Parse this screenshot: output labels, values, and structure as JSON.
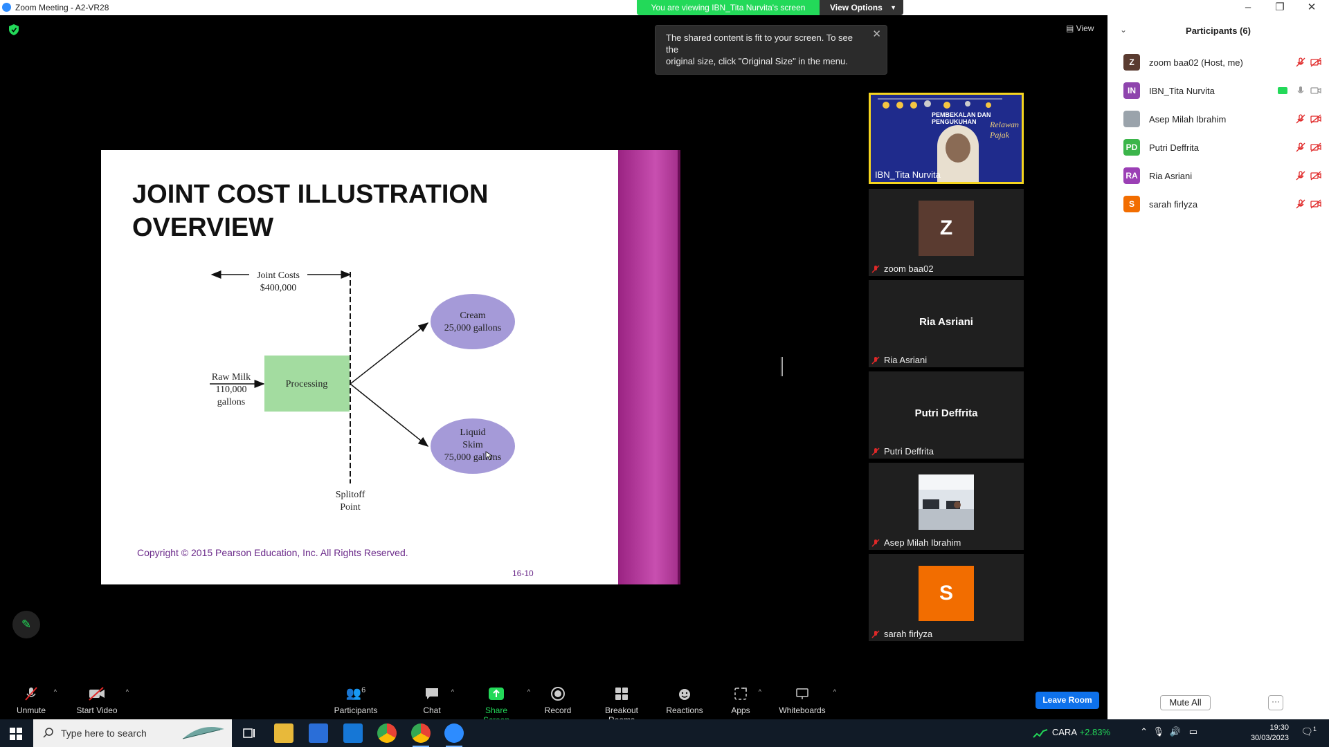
{
  "window": {
    "title": "Zoom Meeting - A2-VR28"
  },
  "view_banner": {
    "message": "You are viewing IBN_Tita Nurvita's screen",
    "options_label": "View Options"
  },
  "tooltip": {
    "text_line1": "The shared content is fit to your screen. To see the",
    "text_line2": "original size, click \"Original Size\" in the menu."
  },
  "view_button": {
    "label": "View"
  },
  "slide": {
    "title_line1": "JOINT COST ILLUSTRATION",
    "title_line2": "OVERVIEW",
    "joint_costs": "Joint Costs",
    "joint_costs_amount": "$400,000",
    "raw_milk": "Raw Milk",
    "raw_milk_qty": "110,000",
    "raw_milk_unit": "gallons",
    "processing": "Processing",
    "cream": "Cream",
    "cream_qty": "25,000 gallons",
    "liquid": "Liquid",
    "skim": "Skim",
    "skim_qty": "75,000 gallons",
    "splitoff": "Splitoff",
    "point": "Point",
    "copyright": "Copyright © 2015 Pearson Education, Inc. All Rights Reserved.",
    "page": "16-10"
  },
  "video_tiles": [
    {
      "name": "IBN_Tita Nurvita",
      "banner_text": "PEMBEKALAN DAN PENGUKUHAN",
      "banner_script": "Relawan Pajak"
    },
    {
      "name": "zoom baa02",
      "initial": "Z",
      "color": "#5a3b30"
    },
    {
      "name": "Ria Asriani",
      "bigname": "Ria Asriani"
    },
    {
      "name": "Putri Deffrita",
      "bigname": "Putri Deffrita"
    },
    {
      "name": "Asep Milah Ibrahim"
    },
    {
      "name": "sarah firlyza",
      "initial": "S",
      "color": "#f26d00"
    }
  ],
  "participants_panel": {
    "title": "Participants (6)",
    "items": [
      {
        "initials": "Z",
        "name": "zoom baa02 (Host, me)",
        "color": "#5a3b30"
      },
      {
        "initials": "IN",
        "name": "IBN_Tita Nurvita",
        "color": "#8e44ad"
      },
      {
        "initials": "",
        "name": "Asep Milah Ibrahim",
        "color": "#9aa3ab"
      },
      {
        "initials": "PD",
        "name": "Putri Deffrita",
        "color": "#3bb54a"
      },
      {
        "initials": "RA",
        "name": "Ria Asriani",
        "color": "#9b3fb5"
      },
      {
        "initials": "S",
        "name": "sarah firlyza",
        "color": "#f26d00"
      }
    ],
    "mute_all": "Mute All",
    "more": "···"
  },
  "toolbar": {
    "unmute": "Unmute",
    "start_video": "Start Video",
    "participants": "Participants",
    "participants_count": "6",
    "chat": "Chat",
    "share_screen": "Share Screen",
    "record": "Record",
    "breakout": "Breakout Rooms",
    "reactions": "Reactions",
    "apps": "Apps",
    "whiteboards": "Whiteboards",
    "leave": "Leave Room"
  },
  "taskbar": {
    "search_placeholder": "Type here to search",
    "stock_name": "CARA",
    "stock_change": "+2.83%",
    "time": "19:30",
    "date": "30/03/2023",
    "notifications": "1"
  }
}
